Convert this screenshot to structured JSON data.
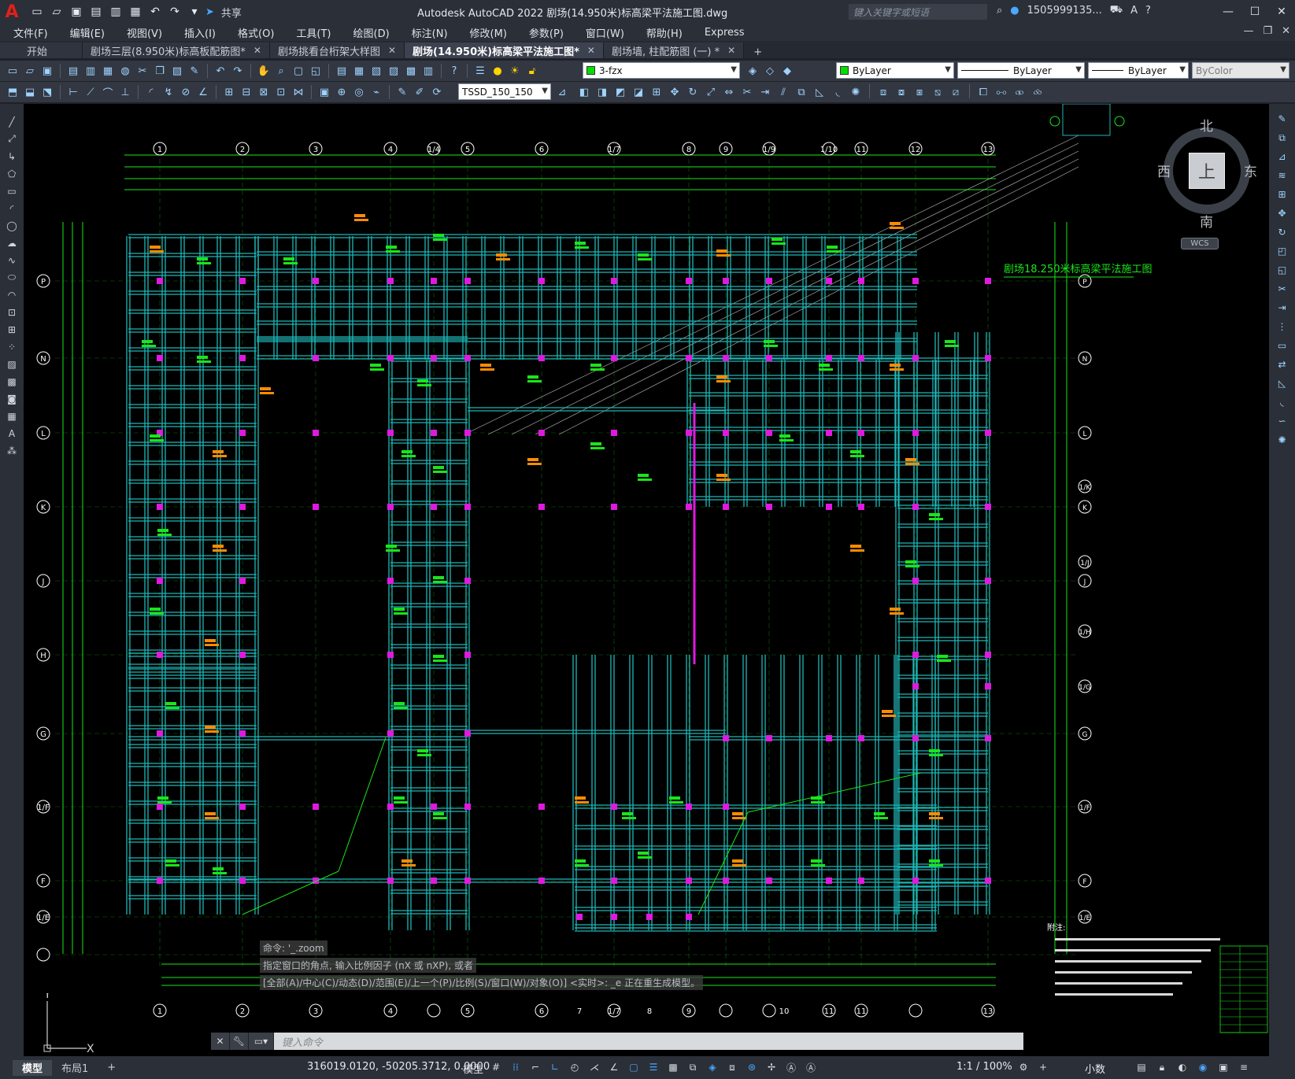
{
  "title_bar": {
    "share_label": "共享",
    "app_title": "Autodesk AutoCAD 2022    剧场(14.950米)标高梁平法施工图.dwg",
    "search_placeholder": "键入关键字或短语",
    "user": "1505999135...",
    "qat_icons": [
      "new-icon",
      "open-icon",
      "save-icon",
      "saveas-icon",
      "print-icon",
      "plot-icon",
      "undo-icon",
      "redo-icon",
      "dropdown-icon"
    ]
  },
  "menu": {
    "items": [
      "文件(F)",
      "编辑(E)",
      "视图(V)",
      "插入(I)",
      "格式(O)",
      "工具(T)",
      "绘图(D)",
      "标注(N)",
      "修改(M)",
      "参数(P)",
      "窗口(W)",
      "帮助(H)",
      "Express"
    ]
  },
  "tabs": [
    {
      "label": "开始",
      "active": false,
      "close": false
    },
    {
      "label": "剧场三层(8.950米)标高板配筋图*",
      "active": false,
      "close": true
    },
    {
      "label": "剧场挑看台桁架大样图",
      "active": false,
      "close": true
    },
    {
      "label": "剧场(14.950米)标高梁平法施工图*",
      "active": true,
      "close": true
    },
    {
      "label": "剧场墙, 柱配筋图 (一) *",
      "active": false,
      "close": true
    }
  ],
  "toolbar": {
    "layer_value": "3-fzx",
    "color_value": "ByLayer",
    "linetype_value": "ByLayer",
    "lineweight_value": "ByLayer",
    "plotstyle_value": "ByColor",
    "dimstyle_value": "TSSD_150_150"
  },
  "viewcube": {
    "north": "北",
    "south": "南",
    "east": "东",
    "west": "西",
    "top": "上",
    "wcs": "WCS"
  },
  "drawing": {
    "top_axes": [
      "1",
      "2",
      "3",
      "4",
      "1/4",
      "5",
      "6",
      "1/7",
      "8",
      "9",
      "1/9",
      "1/10",
      "11",
      "12",
      "13"
    ],
    "bottom_axes": [
      "1",
      "2",
      "3",
      "4",
      "5",
      "6",
      "7",
      "1/7",
      "8",
      "9",
      "10",
      "11",
      "11",
      "13"
    ],
    "left_axes": [
      "P",
      "N",
      "L",
      "K",
      "J",
      "H",
      "G",
      "1/F",
      "F",
      "1/E"
    ],
    "right_axes": [
      "P",
      "N",
      "L",
      "1/K",
      "K",
      "1/J",
      "J",
      "1/H",
      "1/G",
      "G",
      "1/F",
      "F",
      "1/E"
    ],
    "corner_label": "剧场18.250米标高梁平法施工图",
    "notes_title": "附注:"
  },
  "command": {
    "history": [
      "命令: '_.zoom",
      "指定窗口的角点, 输入比例因子 (nX 或 nXP), 或者",
      "[全部(A)/中心(C)/动态(D)/范围(E)/上一个(P)/比例(S)/窗口(W)/对象(O)] <实时>: _e 正在重生成模型。"
    ],
    "placeholder": "键入命令"
  },
  "status": {
    "layout_tabs": [
      "模型",
      "布局1"
    ],
    "coords": "316019.0120, -50205.3712, 0.0000",
    "model_label": "模型",
    "scale": "1:1 / 100%",
    "units": "小数"
  }
}
